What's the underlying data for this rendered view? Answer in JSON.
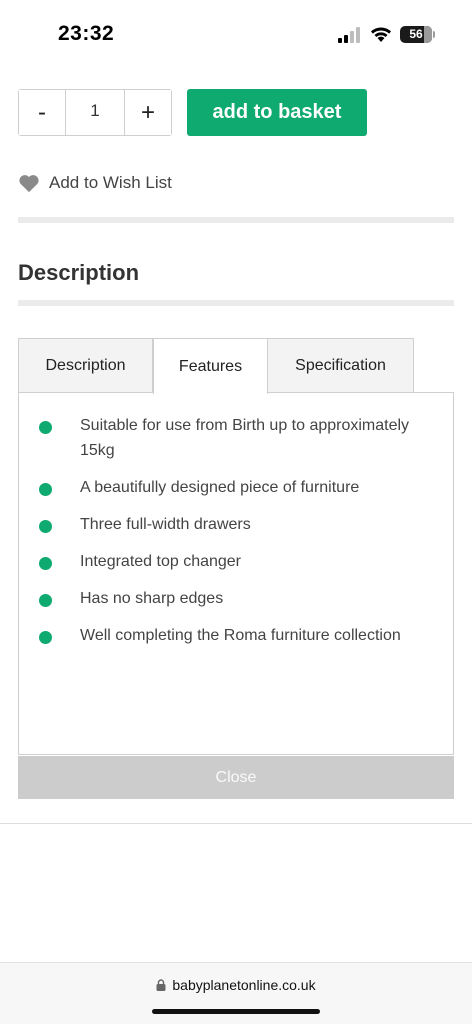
{
  "status_bar": {
    "time": "23:32",
    "battery": "56"
  },
  "product": {
    "quantity": "1",
    "minus_label": "-",
    "plus_label": "+",
    "add_to_basket_label": "add to basket",
    "wish_list_label": "Add to Wish List"
  },
  "section": {
    "title": "Description"
  },
  "tabs": [
    {
      "label": "Description",
      "active": false
    },
    {
      "label": "Features",
      "active": true
    },
    {
      "label": "Specification",
      "active": false
    }
  ],
  "features": [
    "Suitable for use from Birth up to approximately 15kg",
    "A beautifully designed piece of furniture",
    "Three full-width drawers",
    "Integrated top changer",
    "Has no sharp edges",
    "Well completing the Roma furniture collection"
  ],
  "close_label": "Close",
  "browser": {
    "url": "babyplanetonline.co.uk"
  },
  "colors": {
    "accent": "#0faa6f",
    "close_button": "#cccccc"
  }
}
